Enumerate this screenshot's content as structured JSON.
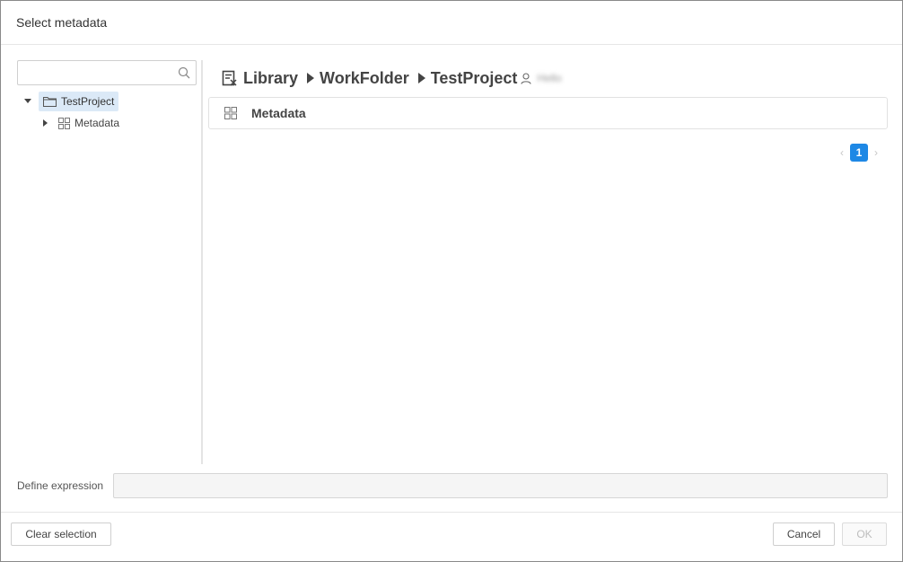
{
  "dialog": {
    "title": "Select metadata"
  },
  "search": {
    "value": "",
    "placeholder": "",
    "icon": "search-icon"
  },
  "tree": {
    "root": {
      "label": "TestProject",
      "icon": "folder-icon",
      "expanded": true,
      "selected": true
    },
    "children": [
      {
        "label": "Metadata",
        "icon": "grid-icon",
        "expanded": false
      }
    ]
  },
  "breadcrumb": {
    "items": [
      "Library",
      "WorkFolder",
      "TestProject"
    ],
    "library_icon": "library-icon",
    "separator_icon": "caret-right-icon",
    "owner_icon": "user-icon",
    "owner": "Hello"
  },
  "list": {
    "items": [
      {
        "label": "Metadata",
        "icon": "grid-icon"
      }
    ]
  },
  "pagination": {
    "current_page": "1"
  },
  "expression": {
    "label": "Define expression",
    "value": ""
  },
  "footer": {
    "clear_label": "Clear selection",
    "cancel_label": "Cancel",
    "ok_label": "OK"
  },
  "colors": {
    "accent": "#1e88e5",
    "selection": "#dbe9f7",
    "border": "#cfcfcf"
  }
}
